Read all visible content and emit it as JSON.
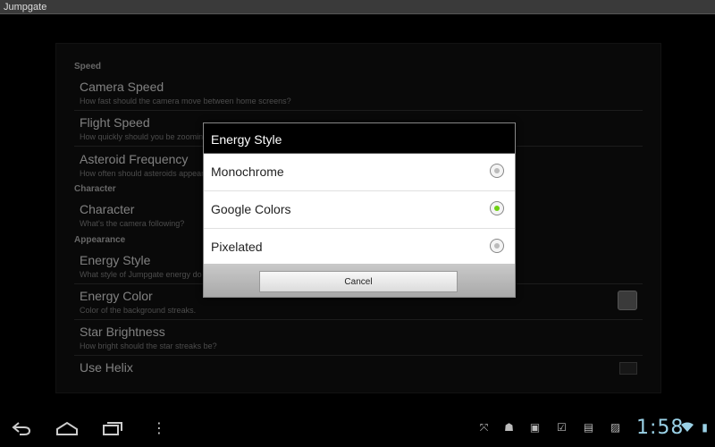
{
  "app": {
    "title": "Jumpgate"
  },
  "sections": {
    "speed": "Speed",
    "character": "Character",
    "appearance": "Appearance"
  },
  "prefs": {
    "camera_speed": {
      "title": "Camera Speed",
      "summary": "How fast should the camera move between home screens?"
    },
    "flight_speed": {
      "title": "Flight Speed",
      "summary": "How quickly should you be zooming"
    },
    "asteroid_frequency": {
      "title": "Asteroid Frequency",
      "summary": "How often should asteroids appear"
    },
    "character": {
      "title": "Character",
      "summary": "What's the camera following?"
    },
    "energy_style": {
      "title": "Energy Style",
      "summary": "What style of Jumpgate energy do y"
    },
    "energy_color": {
      "title": "Energy Color",
      "summary": "Color of the background streaks."
    },
    "star_brightness": {
      "title": "Star Brightness",
      "summary": "How bright should the star streaks be?"
    },
    "use_helix": {
      "title": "Use Helix"
    }
  },
  "dialog": {
    "title": "Energy Style",
    "options": [
      {
        "label": "Monochrome",
        "selected": false
      },
      {
        "label": "Google Colors",
        "selected": true
      },
      {
        "label": "Pixelated",
        "selected": false
      }
    ],
    "cancel": "Cancel"
  },
  "status": {
    "clock": "1:58"
  },
  "colors": {
    "accent": "#6ed012",
    "clock": "#9ad1e6"
  },
  "icons": [
    "back-icon",
    "home-icon",
    "recent-apps-icon",
    "menu-icon",
    "screen-compat-icon",
    "android-icon",
    "bag-icon",
    "checked-bag-icon",
    "notes-icon",
    "image-icon",
    "wifi-icon"
  ]
}
